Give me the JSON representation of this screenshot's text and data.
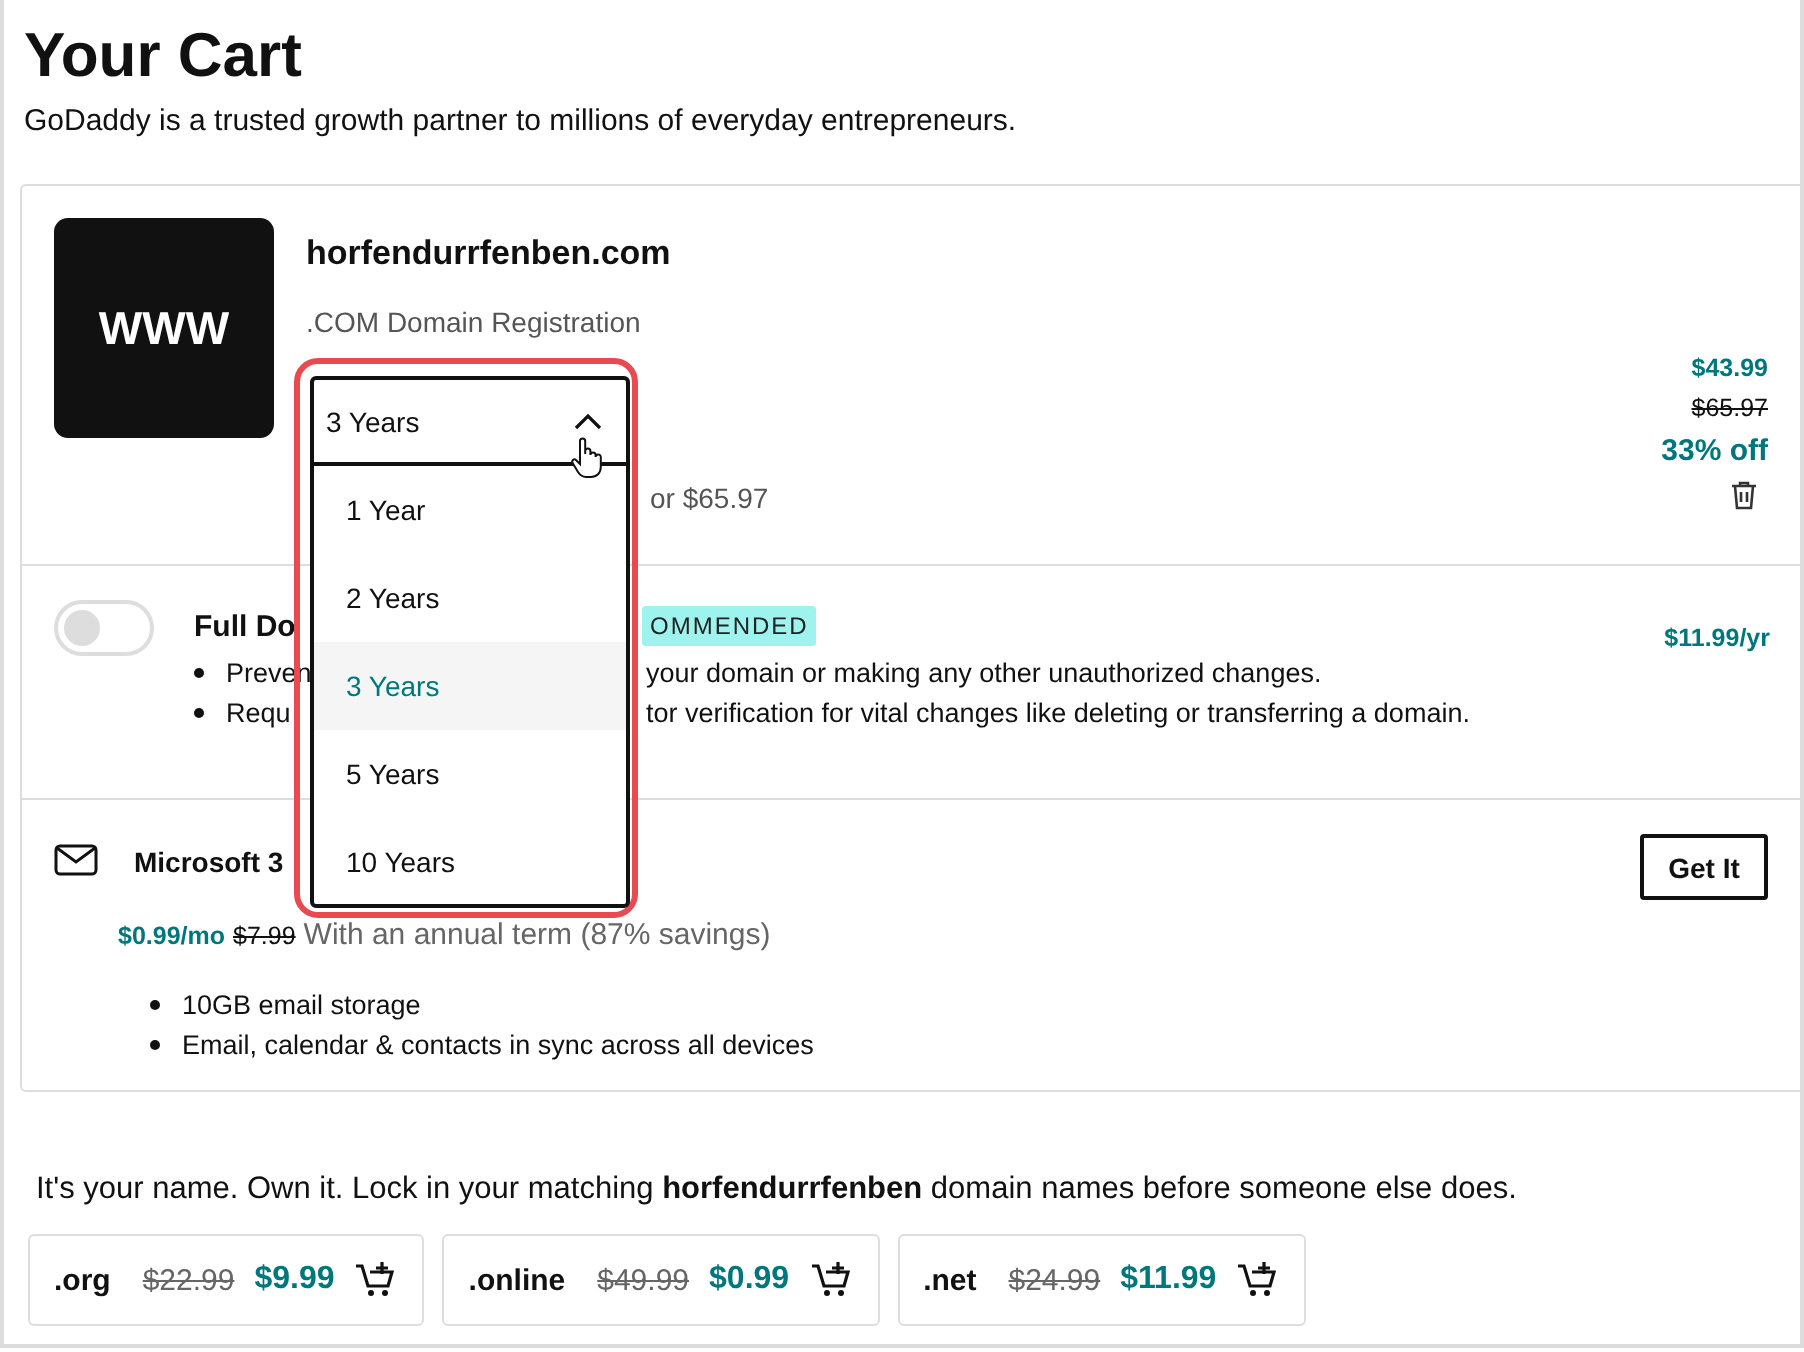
{
  "header": {
    "title": "Your Cart",
    "subtitle": "GoDaddy is a trusted growth partner to millions of everyday entrepreneurs."
  },
  "product": {
    "logo": "WWW",
    "name": "horfendurrfenben.com",
    "type": ".COM Domain Registration",
    "renewal_note": "or $65.97",
    "price": "$43.99",
    "original_price": "$65.97",
    "discount": "33% off",
    "term_select": {
      "value": "3 Years",
      "expanded": true,
      "options": [
        {
          "label": "1 Year",
          "selected": false
        },
        {
          "label": "2 Years",
          "selected": false
        },
        {
          "label": "3 Years",
          "selected": true
        },
        {
          "label": "5 Years",
          "selected": false
        },
        {
          "label": "10 Years",
          "selected": false
        }
      ]
    }
  },
  "protection": {
    "on": false,
    "title": "Full Do",
    "badge": "OMMENDED",
    "price": "$11.99/yr",
    "bullets": [
      {
        "start": "Preven",
        "end": "your domain or making any other unauthorized changes."
      },
      {
        "start": "Requ",
        "end": "tor verification for vital changes like deleting or transferring a domain."
      }
    ]
  },
  "email_offer": {
    "title": "Microsoft 3",
    "price": "$0.99/mo",
    "original_price": "$7.99",
    "note": "With an annual term (87% savings)",
    "button": "Get It",
    "bullets": [
      "10GB email storage",
      "Email, calendar & contacts in sync across all devices"
    ]
  },
  "suggestion": {
    "text": "It's your name. Own it. Lock in your matching **horfendurrfenben** domain names before someone else does.",
    "domains": [
      {
        "tld": ".org",
        "original_price": "$22.99",
        "price": "$9.99"
      },
      {
        "tld": ".online",
        "original_price": "$49.99",
        "price": "$0.99"
      },
      {
        "tld": ".net",
        "original_price": "$24.99",
        "price": "$11.99"
      }
    ]
  }
}
